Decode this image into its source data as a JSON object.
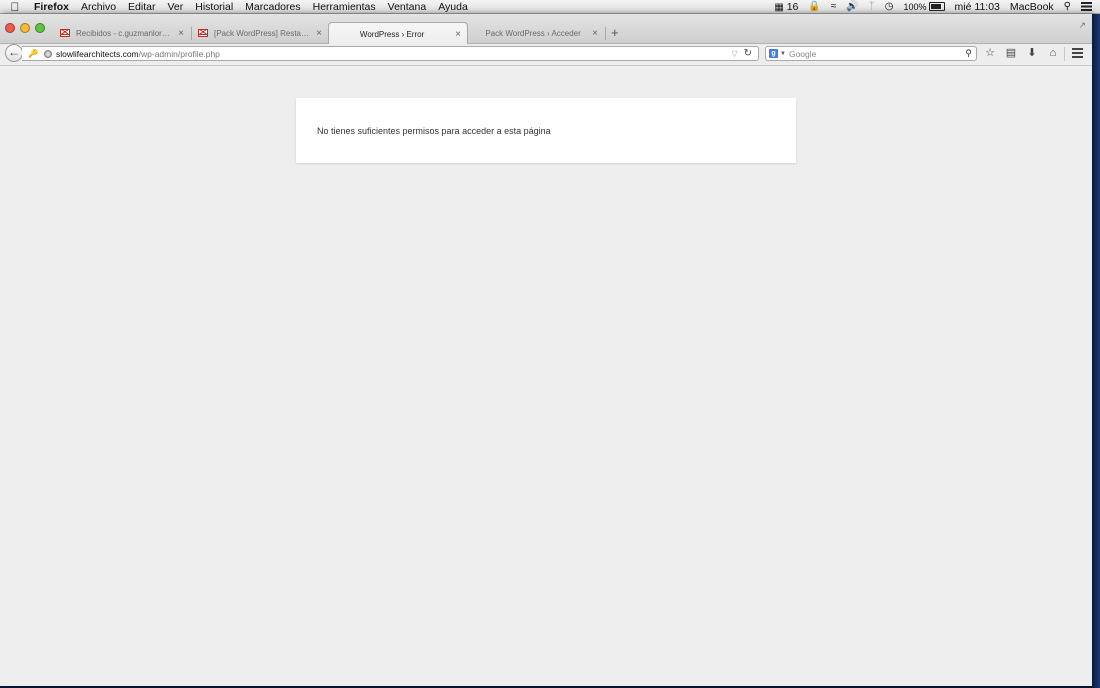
{
  "menubar": {
    "apple": "",
    "app_name": "Firefox",
    "menus": [
      "Archivo",
      "Editar",
      "Ver",
      "Historial",
      "Marcadores",
      "Herramientas",
      "Ventana",
      "Ayuda"
    ],
    "status": {
      "adobe_label": "16",
      "battery_percent": "100%",
      "clock": "mié 11:03",
      "computer_name": "MacBook"
    }
  },
  "tabs": [
    {
      "title": "Recibidos - c.guzmanlore...",
      "favicon": "gmail-icon",
      "active": false
    },
    {
      "title": "[Pack WordPress] Restable...",
      "favicon": "gmail-icon",
      "active": false
    },
    {
      "title": "WordPress › Error",
      "favicon": "",
      "active": true
    },
    {
      "title": "Pack WordPress › Acceder",
      "favicon": "",
      "active": false
    }
  ],
  "navbar": {
    "url_host": "slowlifearchitects.com",
    "url_path": "/wp-admin/profile.php",
    "search_placeholder": "Google"
  },
  "page": {
    "error_message": "No tienes suficientes permisos para acceder a esta página"
  }
}
